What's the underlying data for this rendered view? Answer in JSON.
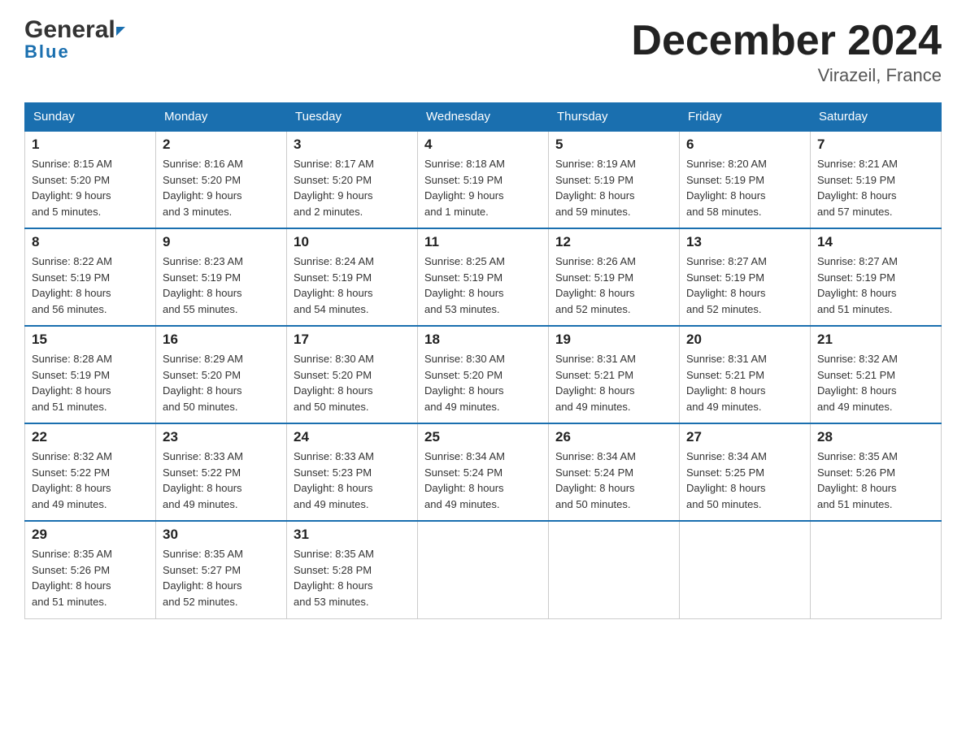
{
  "header": {
    "logo_general": "General",
    "logo_blue": "Blue",
    "month_title": "December 2024",
    "location": "Virazeil, France"
  },
  "days_of_week": [
    "Sunday",
    "Monday",
    "Tuesday",
    "Wednesday",
    "Thursday",
    "Friday",
    "Saturday"
  ],
  "weeks": [
    [
      {
        "day": "1",
        "sunrise": "8:15 AM",
        "sunset": "5:20 PM",
        "daylight": "9 hours and 5 minutes."
      },
      {
        "day": "2",
        "sunrise": "8:16 AM",
        "sunset": "5:20 PM",
        "daylight": "9 hours and 3 minutes."
      },
      {
        "day": "3",
        "sunrise": "8:17 AM",
        "sunset": "5:20 PM",
        "daylight": "9 hours and 2 minutes."
      },
      {
        "day": "4",
        "sunrise": "8:18 AM",
        "sunset": "5:19 PM",
        "daylight": "9 hours and 1 minute."
      },
      {
        "day": "5",
        "sunrise": "8:19 AM",
        "sunset": "5:19 PM",
        "daylight": "8 hours and 59 minutes."
      },
      {
        "day": "6",
        "sunrise": "8:20 AM",
        "sunset": "5:19 PM",
        "daylight": "8 hours and 58 minutes."
      },
      {
        "day": "7",
        "sunrise": "8:21 AM",
        "sunset": "5:19 PM",
        "daylight": "8 hours and 57 minutes."
      }
    ],
    [
      {
        "day": "8",
        "sunrise": "8:22 AM",
        "sunset": "5:19 PM",
        "daylight": "8 hours and 56 minutes."
      },
      {
        "day": "9",
        "sunrise": "8:23 AM",
        "sunset": "5:19 PM",
        "daylight": "8 hours and 55 minutes."
      },
      {
        "day": "10",
        "sunrise": "8:24 AM",
        "sunset": "5:19 PM",
        "daylight": "8 hours and 54 minutes."
      },
      {
        "day": "11",
        "sunrise": "8:25 AM",
        "sunset": "5:19 PM",
        "daylight": "8 hours and 53 minutes."
      },
      {
        "day": "12",
        "sunrise": "8:26 AM",
        "sunset": "5:19 PM",
        "daylight": "8 hours and 52 minutes."
      },
      {
        "day": "13",
        "sunrise": "8:27 AM",
        "sunset": "5:19 PM",
        "daylight": "8 hours and 52 minutes."
      },
      {
        "day": "14",
        "sunrise": "8:27 AM",
        "sunset": "5:19 PM",
        "daylight": "8 hours and 51 minutes."
      }
    ],
    [
      {
        "day": "15",
        "sunrise": "8:28 AM",
        "sunset": "5:19 PM",
        "daylight": "8 hours and 51 minutes."
      },
      {
        "day": "16",
        "sunrise": "8:29 AM",
        "sunset": "5:20 PM",
        "daylight": "8 hours and 50 minutes."
      },
      {
        "day": "17",
        "sunrise": "8:30 AM",
        "sunset": "5:20 PM",
        "daylight": "8 hours and 50 minutes."
      },
      {
        "day": "18",
        "sunrise": "8:30 AM",
        "sunset": "5:20 PM",
        "daylight": "8 hours and 49 minutes."
      },
      {
        "day": "19",
        "sunrise": "8:31 AM",
        "sunset": "5:21 PM",
        "daylight": "8 hours and 49 minutes."
      },
      {
        "day": "20",
        "sunrise": "8:31 AM",
        "sunset": "5:21 PM",
        "daylight": "8 hours and 49 minutes."
      },
      {
        "day": "21",
        "sunrise": "8:32 AM",
        "sunset": "5:21 PM",
        "daylight": "8 hours and 49 minutes."
      }
    ],
    [
      {
        "day": "22",
        "sunrise": "8:32 AM",
        "sunset": "5:22 PM",
        "daylight": "8 hours and 49 minutes."
      },
      {
        "day": "23",
        "sunrise": "8:33 AM",
        "sunset": "5:22 PM",
        "daylight": "8 hours and 49 minutes."
      },
      {
        "day": "24",
        "sunrise": "8:33 AM",
        "sunset": "5:23 PM",
        "daylight": "8 hours and 49 minutes."
      },
      {
        "day": "25",
        "sunrise": "8:34 AM",
        "sunset": "5:24 PM",
        "daylight": "8 hours and 49 minutes."
      },
      {
        "day": "26",
        "sunrise": "8:34 AM",
        "sunset": "5:24 PM",
        "daylight": "8 hours and 50 minutes."
      },
      {
        "day": "27",
        "sunrise": "8:34 AM",
        "sunset": "5:25 PM",
        "daylight": "8 hours and 50 minutes."
      },
      {
        "day": "28",
        "sunrise": "8:35 AM",
        "sunset": "5:26 PM",
        "daylight": "8 hours and 51 minutes."
      }
    ],
    [
      {
        "day": "29",
        "sunrise": "8:35 AM",
        "sunset": "5:26 PM",
        "daylight": "8 hours and 51 minutes."
      },
      {
        "day": "30",
        "sunrise": "8:35 AM",
        "sunset": "5:27 PM",
        "daylight": "8 hours and 52 minutes."
      },
      {
        "day": "31",
        "sunrise": "8:35 AM",
        "sunset": "5:28 PM",
        "daylight": "8 hours and 53 minutes."
      },
      null,
      null,
      null,
      null
    ]
  ]
}
